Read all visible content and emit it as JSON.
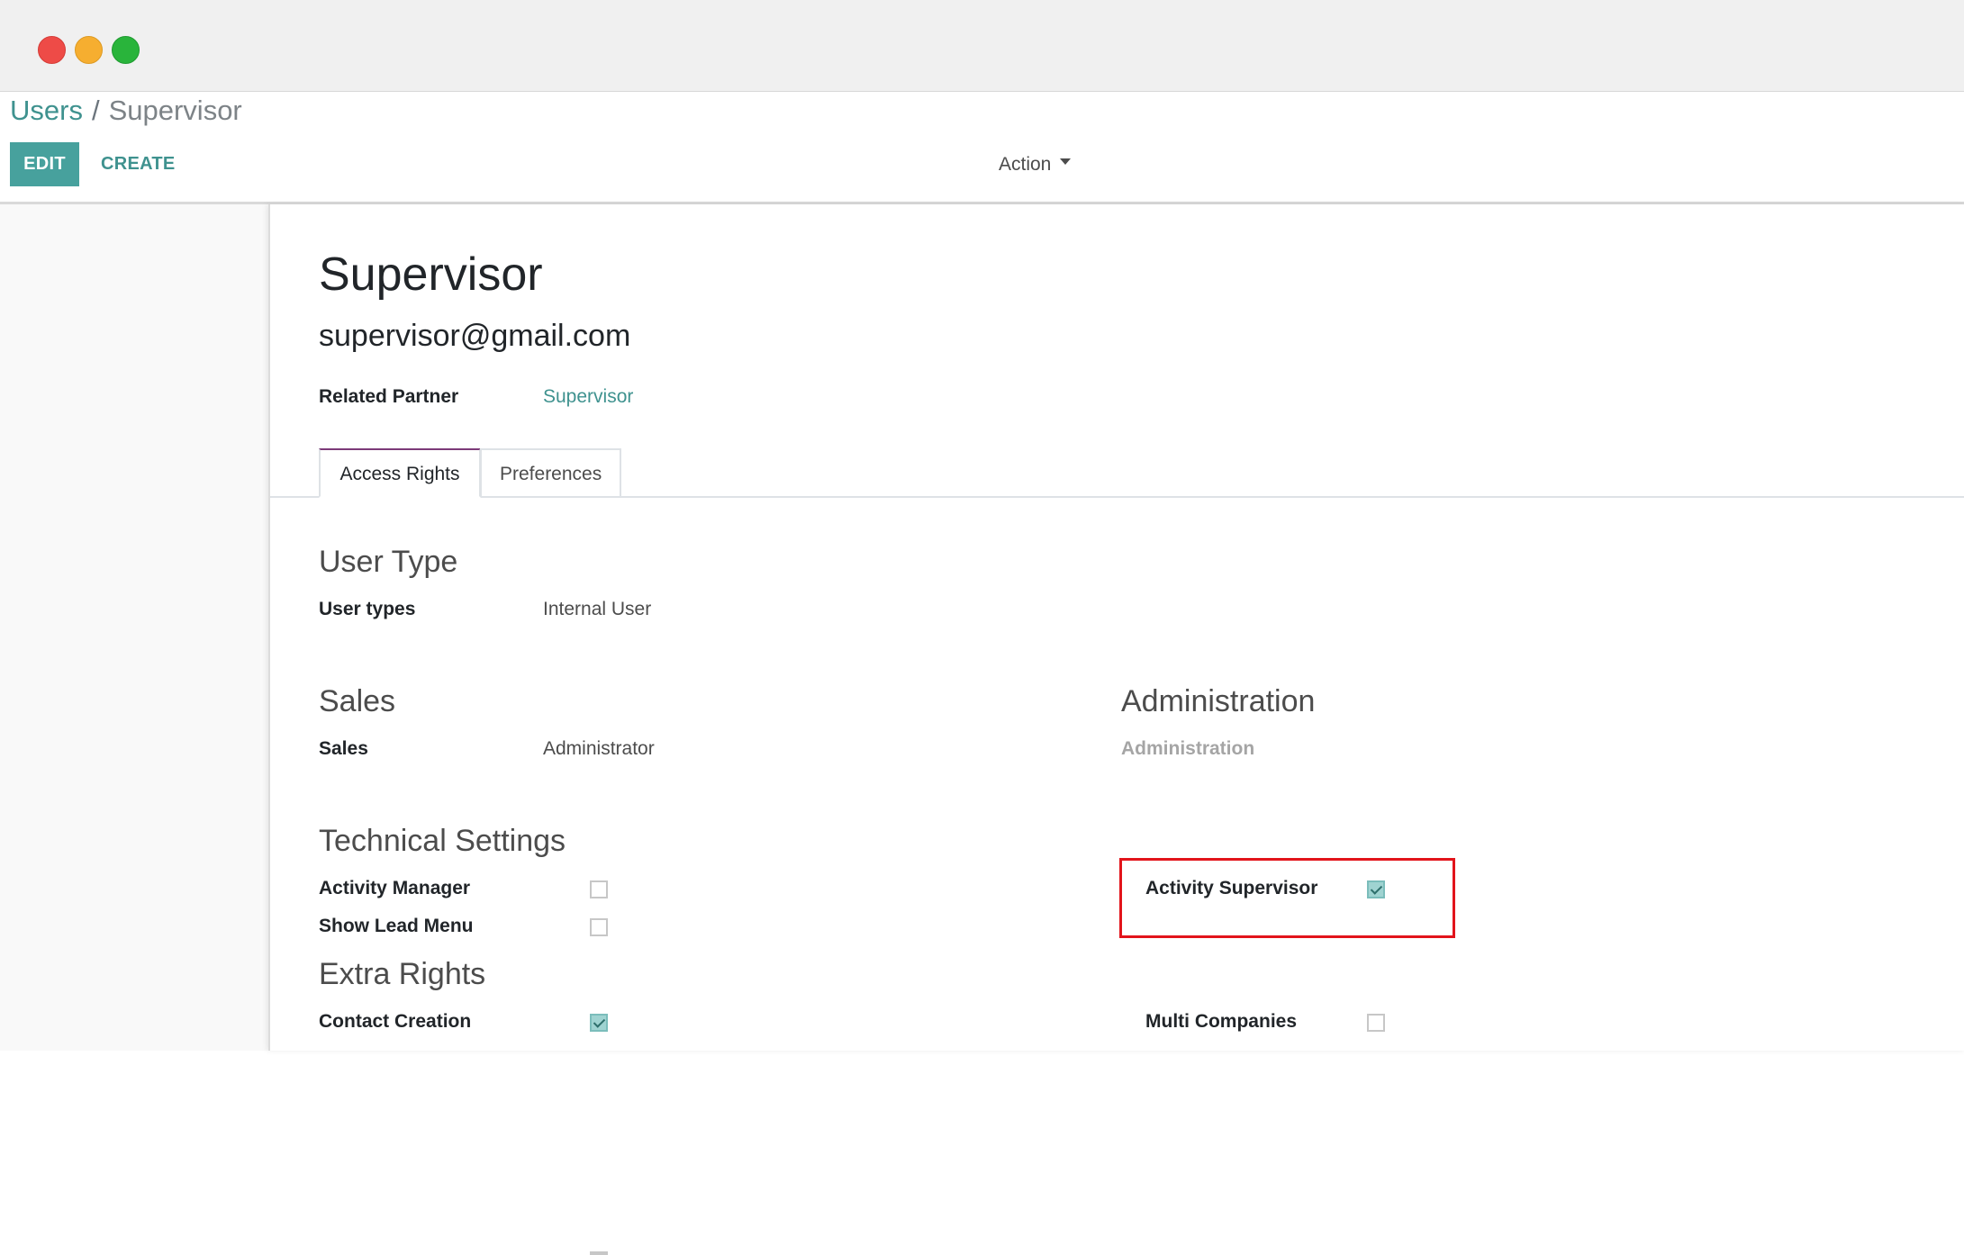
{
  "breadcrumb": {
    "parent": "Users",
    "separator": "/",
    "current": "Supervisor"
  },
  "toolbar": {
    "edit_label": "EDIT",
    "create_label": "CREATE",
    "action_label": "Action"
  },
  "record": {
    "title": "Supervisor",
    "email": "supervisor@gmail.com",
    "related_partner_label": "Related Partner",
    "related_partner_value": "Supervisor"
  },
  "tabs": [
    {
      "label": "Access Rights",
      "active": true
    },
    {
      "label": "Preferences",
      "active": false
    }
  ],
  "user_type": {
    "title": "User Type",
    "label": "User types",
    "value": "Internal User"
  },
  "sales": {
    "title": "Sales",
    "label": "Sales",
    "value": "Administrator"
  },
  "administration": {
    "title": "Administration",
    "label": "Administration"
  },
  "technical_settings": {
    "title": "Technical Settings",
    "items": [
      {
        "label": "Activity Manager",
        "checked": false
      },
      {
        "label": "Show Lead Menu",
        "checked": false
      },
      {
        "label": "Activity Supervisor",
        "checked": true
      }
    ]
  },
  "extra_rights": {
    "title": "Extra Rights",
    "items": [
      {
        "label": "Contact Creation",
        "checked": true
      },
      {
        "label": "Multi Companies",
        "checked": false
      }
    ]
  },
  "colors": {
    "primary": "#47a19d",
    "link": "#3f928f",
    "highlight": "#e2141b",
    "tab_accent": "#7c3a78"
  }
}
